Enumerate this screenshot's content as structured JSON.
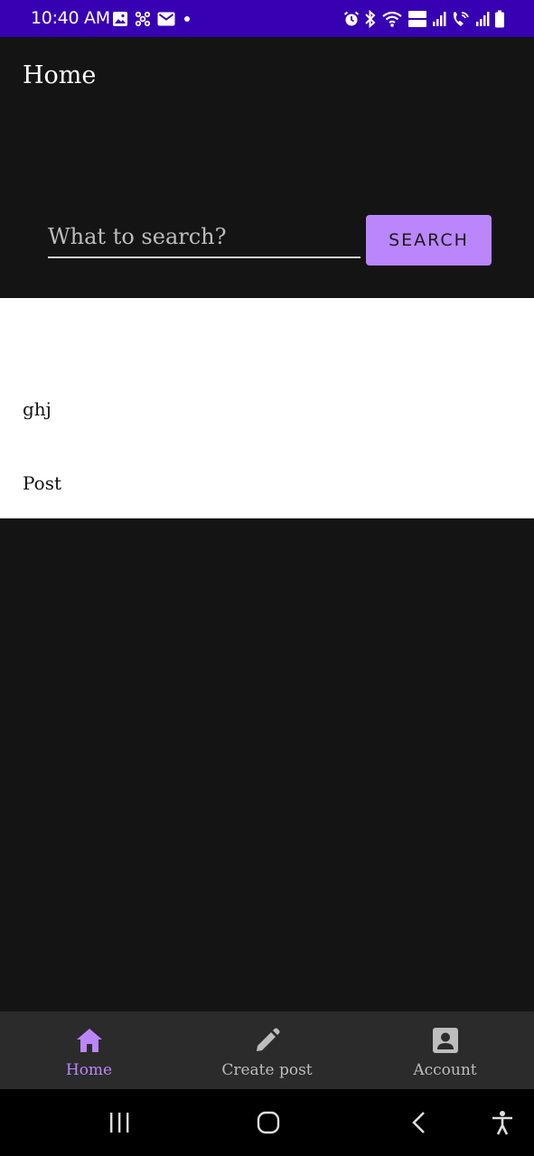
{
  "status_bar": {
    "time": "10:40 AM"
  },
  "app_bar": {
    "title": "Home"
  },
  "search": {
    "placeholder": "What to search?",
    "value": "",
    "button_label": "SEARCH"
  },
  "posts": [
    {
      "text": "ghj"
    },
    {
      "text": "Post"
    }
  ],
  "bottom_nav": {
    "items": [
      {
        "label": "Home",
        "icon": "home-icon",
        "active": true
      },
      {
        "label": "Create post",
        "icon": "pencil-icon",
        "active": false
      },
      {
        "label": "Account",
        "icon": "account-box-icon",
        "active": false
      }
    ]
  },
  "colors": {
    "status_bar": "#3700b3",
    "background": "#141414",
    "accent": "#bb86fc",
    "nav_background": "#2b2b2b"
  }
}
